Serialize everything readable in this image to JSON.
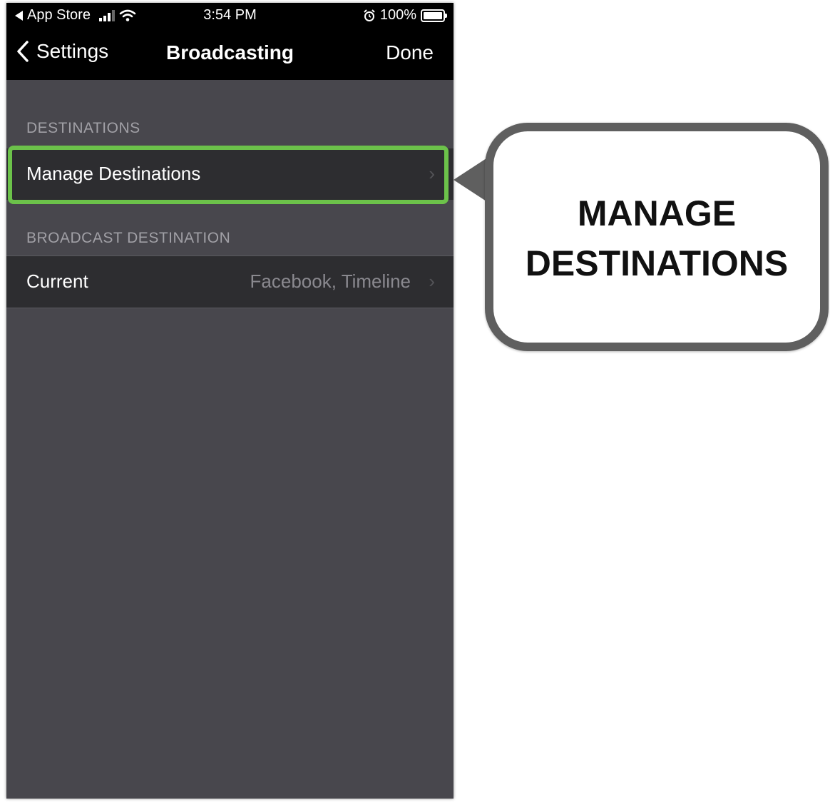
{
  "status_bar": {
    "back_app": "App Store",
    "time": "3:54 PM",
    "battery": "100%",
    "icons": [
      "signal-icon",
      "wifi-icon",
      "alarm-icon",
      "battery-icon"
    ]
  },
  "nav": {
    "back_label": "Settings",
    "title": "Broadcasting",
    "done_label": "Done"
  },
  "sections": [
    {
      "header": "DESTINATIONS",
      "rows": [
        {
          "label": "Manage Destinations",
          "value": ""
        }
      ]
    },
    {
      "header": "BROADCAST DESTINATION",
      "rows": [
        {
          "label": "Current",
          "value": "Facebook, Timeline"
        }
      ]
    }
  ],
  "callout": {
    "line1": "MANAGE",
    "line2": "DESTINATIONS"
  },
  "colors": {
    "highlight": "#6cc24a",
    "background": "#48474d",
    "row": "#2d2d30",
    "callout_border": "#5f5f5f"
  }
}
